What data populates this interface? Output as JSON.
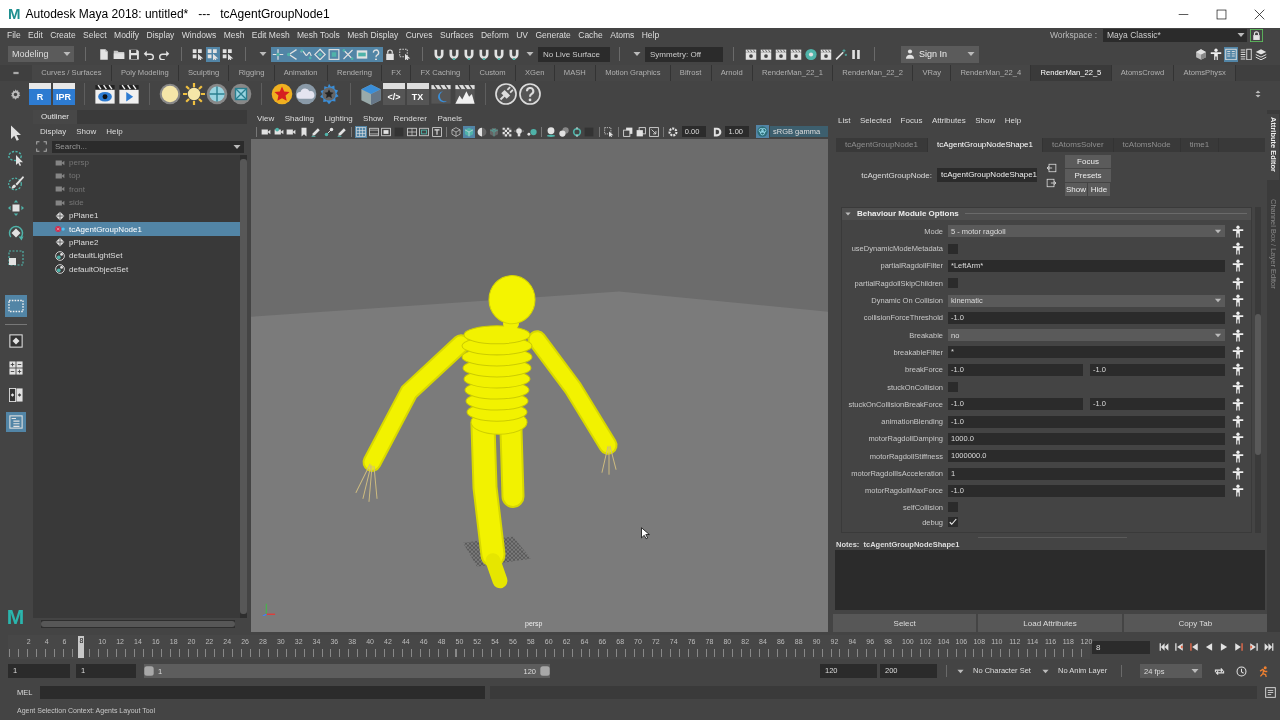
{
  "window": {
    "logo": "M",
    "title": "Autodesk Maya 2018: untitled*   ---   tcAgentGroupNode1"
  },
  "menu_bar": [
    "File",
    "Edit",
    "Create",
    "Select",
    "Modify",
    "Display",
    "Windows",
    "Mesh",
    "Edit Mesh",
    "Mesh Tools",
    "Mesh Display",
    "Curves",
    "Surfaces",
    "Deform",
    "UV",
    "Generate",
    "Cache",
    "Atoms",
    "Help"
  ],
  "workspace": {
    "label": "Workspace :",
    "value": "Maya Classic*"
  },
  "status_line": {
    "menu_set": "Modeling",
    "select_modes": [
      {
        "selected": false
      },
      {
        "selected": true
      },
      {
        "selected": false
      }
    ],
    "selection_masks": [
      {
        "on": true
      },
      {
        "on": true
      },
      {
        "on": true
      },
      {
        "on": true
      },
      {
        "on": true
      },
      {
        "on": true
      },
      {
        "on": true
      },
      {
        "on": true
      }
    ],
    "live_surface": "No Live Surface",
    "symmetry": "Symmetry: Off",
    "sign_in": "Sign In",
    "panel_toggles": [
      {
        "on": false
      },
      {
        "on": false
      },
      {
        "on": true
      },
      {
        "on": false
      },
      {
        "on": false
      }
    ]
  },
  "shelf_tabs": [
    {
      "label": "Curves / Surfaces",
      "selected": false
    },
    {
      "label": "Poly Modeling",
      "selected": false
    },
    {
      "label": "Sculpting",
      "selected": false
    },
    {
      "label": "Rigging",
      "selected": false
    },
    {
      "label": "Animation",
      "selected": false
    },
    {
      "label": "Rendering",
      "selected": false
    },
    {
      "label": "FX",
      "selected": false
    },
    {
      "label": "FX Caching",
      "selected": false
    },
    {
      "label": "Custom",
      "selected": false
    },
    {
      "label": "XGen",
      "selected": false
    },
    {
      "label": "MASH",
      "selected": false
    },
    {
      "label": "Motion Graphics",
      "selected": false
    },
    {
      "label": "Bifrost",
      "selected": false
    },
    {
      "label": "Arnold",
      "selected": false
    },
    {
      "label": "RenderMan_22_1",
      "selected": false
    },
    {
      "label": "RenderMan_22_2",
      "selected": false
    },
    {
      "label": "VRay",
      "selected": false
    },
    {
      "label": "RenderMan_22_4",
      "selected": false
    },
    {
      "label": "RenderMan_22_5",
      "selected": true
    },
    {
      "label": "AtomsCrowd",
      "selected": false
    },
    {
      "label": "AtomsPhysx",
      "selected": false
    }
  ],
  "shelf_buttons": [
    {
      "label": "R",
      "kind": "render"
    },
    {
      "label": "IPR",
      "kind": "render"
    },
    {
      "label": "</>",
      "kind": "tool"
    },
    {
      "label": "TX",
      "kind": "tool"
    }
  ],
  "toolbox": {
    "tools": [
      {
        "kind": "arrow",
        "selected": false
      },
      {
        "kind": "lasso",
        "selected": false
      },
      {
        "kind": "brush",
        "selected": false
      },
      {
        "kind": "move",
        "selected": false
      },
      {
        "kind": "rotate",
        "selected": false
      },
      {
        "kind": "scale",
        "selected": false
      },
      {
        "kind": "marquee",
        "selected": true
      }
    ],
    "layouts": [
      {
        "kind": "single",
        "selected": false
      },
      {
        "kind": "quad",
        "selected": false
      },
      {
        "kind": "split",
        "selected": false
      },
      {
        "kind": "outliner",
        "selected": true
      }
    ],
    "logo": "M"
  },
  "outliner": {
    "tab": "Outliner",
    "menu": [
      "Display",
      "Show",
      "Help"
    ],
    "search": {
      "placeholder": "Search..."
    },
    "items": [
      {
        "label": "persp",
        "kind": "camera",
        "hidden": true,
        "selected": false
      },
      {
        "label": "top",
        "kind": "camera",
        "hidden": true,
        "selected": false
      },
      {
        "label": "front",
        "kind": "camera",
        "hidden": true,
        "selected": false
      },
      {
        "label": "side",
        "kind": "camera",
        "hidden": true,
        "selected": false
      },
      {
        "label": "pPlane1",
        "kind": "mesh",
        "hidden": false,
        "selected": false
      },
      {
        "label": "tcAgentGroupNode1",
        "kind": "agent",
        "hidden": false,
        "selected": true
      },
      {
        "label": "pPlane2",
        "kind": "mesh",
        "hidden": false,
        "selected": false
      },
      {
        "label": "defaultLightSet",
        "kind": "set",
        "hidden": false,
        "selected": false
      },
      {
        "label": "defaultObjectSet",
        "kind": "set",
        "hidden": false,
        "selected": false
      }
    ]
  },
  "viewport": {
    "menu": [
      "View",
      "Shading",
      "Lighting",
      "Show",
      "Renderer",
      "Panels"
    ],
    "display_buttons": [
      {
        "on": true
      },
      {
        "on": false
      },
      {
        "on": false
      },
      {
        "on": false
      },
      {
        "on": false
      },
      {
        "on": false
      },
      {
        "on": false
      },
      {
        "on": false
      },
      {
        "on": true
      },
      {
        "on": false
      },
      {
        "on": false
      },
      {
        "on": false
      },
      {
        "on": false
      },
      {
        "on": false
      }
    ],
    "exposure": "0.00",
    "gamma": "1.00",
    "color_management": {
      "on": true,
      "label": "sRGB gamma"
    },
    "camera": "persp"
  },
  "attribute_editor": {
    "menu": [
      "List",
      "Selected",
      "Focus",
      "Attributes",
      "Show",
      "Help"
    ],
    "tabs": [
      {
        "label": "tcAgentGroupNode1",
        "selected": false
      },
      {
        "label": "tcAgentGroupNodeShape1",
        "selected": true
      },
      {
        "label": "tcAtomsSolver",
        "selected": false
      },
      {
        "label": "tcAtomsNode",
        "selected": false
      },
      {
        "label": "time1",
        "selected": false
      }
    ],
    "node_label": "tcAgentGroupNode:",
    "node_name": "tcAgentGroupNodeShape1",
    "buttons": [
      "Focus",
      "Presets",
      "Show",
      "Hide"
    ],
    "section": {
      "title": "Behaviour Module Options",
      "expanded": true,
      "rows": [
        {
          "label": "Mode",
          "kind": "dropdown",
          "value": "5 - motor ragdoll",
          "map_button": true
        },
        {
          "label": "useDynamicModeMetadata",
          "kind": "checkbox",
          "checked": false,
          "map_button": true
        },
        {
          "label": "partialRagdollFilter",
          "kind": "text",
          "value": "*LeftArm*",
          "map_button": true
        },
        {
          "label": "partialRagdollSkipChildren",
          "kind": "checkbox",
          "checked": false,
          "map_button": true
        },
        {
          "label": "Dynamic On Collision",
          "kind": "dropdown",
          "value": "kinematic",
          "map_button": true
        },
        {
          "label": "collisionForceThreshold",
          "kind": "text",
          "value": "-1.0",
          "map_button": true
        },
        {
          "label": "Breakable",
          "kind": "dropdown",
          "value": "no",
          "map_button": true
        },
        {
          "label": "breakableFilter",
          "kind": "text",
          "value": "*",
          "map_button": true
        },
        {
          "label": "breakForce",
          "kind": "pair",
          "values": [
            "-1.0",
            "-1.0"
          ],
          "map_button": true
        },
        {
          "label": "stuckOnCollision",
          "kind": "checkbox",
          "checked": false,
          "map_button": true
        },
        {
          "label": "stuckOnCollisionBreakForce",
          "kind": "pair",
          "values": [
            "-1.0",
            "-1.0"
          ],
          "map_button": true
        },
        {
          "label": "animationBlending",
          "kind": "text",
          "value": "-1.0",
          "map_button": true
        },
        {
          "label": "motorRagdollDamping",
          "kind": "text",
          "value": "1000.0",
          "map_button": true
        },
        {
          "label": "motorRagdollStiffness",
          "kind": "text",
          "value": "1000000.0",
          "map_button": true
        },
        {
          "label": "motorRagdollIsAcceleration",
          "kind": "text",
          "value": "1",
          "map_button": true
        },
        {
          "label": "motorRagdollMaxForce",
          "kind": "text",
          "value": "-1.0",
          "map_button": true
        },
        {
          "label": "selfCollision",
          "kind": "checkbox",
          "checked": false,
          "map_button": false
        },
        {
          "label": "debug",
          "kind": "checkbox",
          "checked": true,
          "map_button": false
        }
      ]
    },
    "notes_title": "Notes:  tcAgentGroupNodeShape1",
    "footer_buttons": [
      "Select",
      "Load Attributes",
      "Copy Tab"
    ]
  },
  "side_tabs": [
    {
      "label": "Attribute Editor",
      "selected": true
    },
    {
      "label": "Channel Box / Layer Editor",
      "selected": false
    }
  ],
  "time_slider": {
    "ticks": [
      {
        "label": "2",
        "selected": false
      },
      {
        "label": "4",
        "selected": false
      },
      {
        "label": "6",
        "selected": false
      },
      {
        "label": "8",
        "selected": true
      },
      {
        "label": "10",
        "selected": false
      },
      {
        "label": "12",
        "selected": false
      },
      {
        "label": "14",
        "selected": false
      },
      {
        "label": "16",
        "selected": false
      },
      {
        "label": "18",
        "selected": false
      },
      {
        "label": "20",
        "selected": false
      },
      {
        "label": "22",
        "selected": false
      },
      {
        "label": "24",
        "selected": false
      },
      {
        "label": "26",
        "selected": false
      },
      {
        "label": "28",
        "selected": false
      },
      {
        "label": "30",
        "selected": false
      },
      {
        "label": "32",
        "selected": false
      },
      {
        "label": "34",
        "selected": false
      },
      {
        "label": "36",
        "selected": false
      },
      {
        "label": "38",
        "selected": false
      },
      {
        "label": "40",
        "selected": false
      },
      {
        "label": "42",
        "selected": false
      },
      {
        "label": "44",
        "selected": false
      },
      {
        "label": "46",
        "selected": false
      },
      {
        "label": "48",
        "selected": false
      },
      {
        "label": "50",
        "selected": false
      },
      {
        "label": "52",
        "selected": false
      },
      {
        "label": "54",
        "selected": false
      },
      {
        "label": "56",
        "selected": false
      },
      {
        "label": "58",
        "selected": false
      },
      {
        "label": "60",
        "selected": false
      },
      {
        "label": "62",
        "selected": false
      },
      {
        "label": "64",
        "selected": false
      },
      {
        "label": "66",
        "selected": false
      },
      {
        "label": "68",
        "selected": false
      },
      {
        "label": "70",
        "selected": false
      },
      {
        "label": "72",
        "selected": false
      },
      {
        "label": "74",
        "selected": false
      },
      {
        "label": "76",
        "selected": false
      },
      {
        "label": "78",
        "selected": false
      },
      {
        "label": "80",
        "selected": false
      },
      {
        "label": "82",
        "selected": false
      },
      {
        "label": "84",
        "selected": false
      },
      {
        "label": "86",
        "selected": false
      },
      {
        "label": "88",
        "selected": false
      },
      {
        "label": "90",
        "selected": false
      },
      {
        "label": "92",
        "selected": false
      },
      {
        "label": "94",
        "selected": false
      },
      {
        "label": "96",
        "selected": false
      },
      {
        "label": "98",
        "selected": false
      },
      {
        "label": "100",
        "selected": false
      },
      {
        "label": "102",
        "selected": false
      },
      {
        "label": "104",
        "selected": false
      },
      {
        "label": "106",
        "selected": false
      },
      {
        "label": "108",
        "selected": false
      },
      {
        "label": "110",
        "selected": false
      },
      {
        "label": "112",
        "selected": false
      },
      {
        "label": "114",
        "selected": false
      },
      {
        "label": "116",
        "selected": false
      },
      {
        "label": "118",
        "selected": false
      },
      {
        "label": "120",
        "selected": false
      }
    ],
    "current_frame": "8"
  },
  "range_slider": {
    "start": "1",
    "playback_start": "1",
    "range_start": "1",
    "range_end": "120",
    "level": 1,
    "playback_end": "120",
    "end": "200",
    "character_set": "No Character Set",
    "anim_layer": "No Anim Layer",
    "fps": "24 fps"
  },
  "command_line": {
    "language": "MEL"
  },
  "help_line": "Agent Selection Context: Agents Layout Tool"
}
